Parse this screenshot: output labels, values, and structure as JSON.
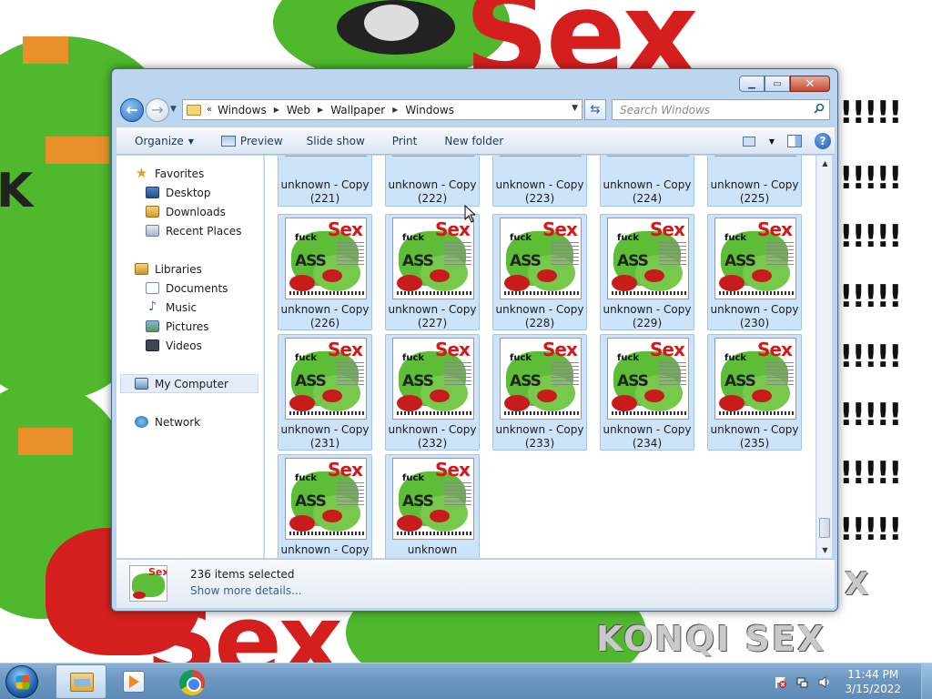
{
  "wallpaper": {
    "big_text": "Sex",
    "exclamation": "!!!!!",
    "bottom_text": "KONQI SEX",
    "side_text_1": "K",
    "side_text_2": "X"
  },
  "window": {
    "address": {
      "overflow_chevron": "«",
      "crumbs": [
        "Windows",
        "Web",
        "Wallpaper",
        "Windows"
      ]
    },
    "search": {
      "placeholder": "Search Windows"
    },
    "toolbar": {
      "organize": "Organize",
      "preview": "Preview",
      "slide_show": "Slide show",
      "print": "Print",
      "new_folder": "New folder"
    },
    "nav": {
      "favorites": "Favorites",
      "desktop": "Desktop",
      "downloads": "Downloads",
      "recent_places": "Recent Places",
      "libraries": "Libraries",
      "documents": "Documents",
      "music": "Music",
      "pictures": "Pictures",
      "videos": "Videos",
      "my_computer": "My Computer",
      "network": "Network"
    },
    "files": {
      "row1": [
        {
          "name": "unknown - Copy",
          "num": "(221)"
        },
        {
          "name": "unknown - Copy",
          "num": "(222)"
        },
        {
          "name": "unknown - Copy",
          "num": "(223)"
        },
        {
          "name": "unknown - Copy",
          "num": "(224)"
        },
        {
          "name": "unknown - Copy",
          "num": "(225)"
        }
      ],
      "row2": [
        {
          "name": "unknown - Copy",
          "num": "(226)"
        },
        {
          "name": "unknown - Copy",
          "num": "(227)"
        },
        {
          "name": "unknown - Copy",
          "num": "(228)"
        },
        {
          "name": "unknown - Copy",
          "num": "(229)"
        },
        {
          "name": "unknown - Copy",
          "num": "(230)"
        }
      ],
      "row3": [
        {
          "name": "unknown - Copy",
          "num": "(231)"
        },
        {
          "name": "unknown - Copy",
          "num": "(232)"
        },
        {
          "name": "unknown - Copy",
          "num": "(233)"
        },
        {
          "name": "unknown - Copy",
          "num": "(234)"
        },
        {
          "name": "unknown - Copy",
          "num": "(235)"
        }
      ],
      "row4": [
        {
          "name": "unknown - Copy",
          "num": ""
        },
        {
          "name": "unknown",
          "num": ""
        }
      ]
    },
    "thumb_text": {
      "sex": "Sex",
      "fuck": "fuck",
      "ass": "ASS"
    },
    "details": {
      "title": "236 items selected",
      "more": "Show more details..."
    }
  },
  "taskbar": {
    "clock_time": "11:44 PM",
    "clock_date": "3/15/2022"
  }
}
